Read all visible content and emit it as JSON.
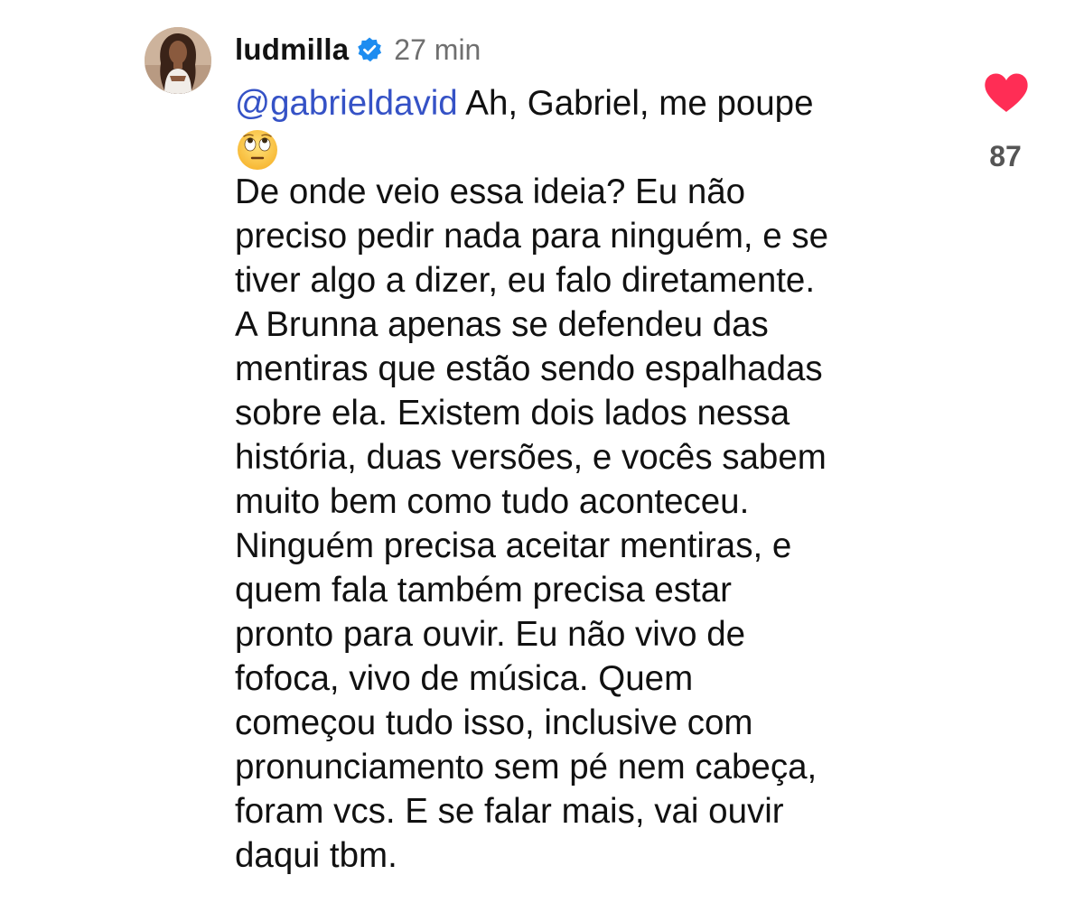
{
  "comment": {
    "username": "ludmilla",
    "timestamp": "27 min",
    "mention": "@gabrieldavid",
    "first_line_text": " Ah, Gabriel, me poupe",
    "emoji": "face-with-rolling-eyes-emoji",
    "body_lines": [
      "De onde veio essa ideia? Eu não",
      "preciso pedir nada para ninguém, e se",
      "tiver algo a dizer, eu falo diretamente.",
      "A Brunna apenas se defendeu das",
      "mentiras que estão sendo espalhadas",
      "sobre ela. Existem dois lados nessa",
      "história, duas versões, e vocês sabem",
      "muito bem como tudo aconteceu.",
      "Ninguém precisa aceitar mentiras, e",
      "quem fala também precisa estar",
      "pronto para ouvir. Eu não vivo de",
      "fofoca, vivo de música. Quem",
      "começou tudo isso, inclusive com",
      "pronunciamento sem pé nem cabeça,",
      "foram vcs. E se falar mais, vai ouvir",
      "daqui tbm."
    ]
  },
  "like": {
    "icon": "heart-icon",
    "liked": true,
    "count": "87"
  },
  "colors": {
    "mention": "#3552c6",
    "heart": "#ff2d55",
    "verified_badge": "#1d8cf0",
    "timestamp": "#6f6f6f"
  }
}
